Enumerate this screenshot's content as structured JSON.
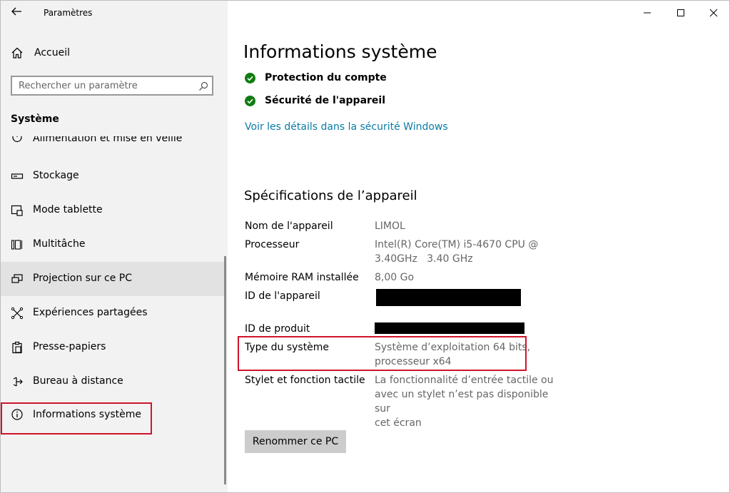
{
  "window": {
    "title": "Paramètres"
  },
  "sidebar": {
    "home_label": "Accueil",
    "search_placeholder": "Rechercher un paramètre",
    "section_label": "Système",
    "items": [
      {
        "label": "Alimentation et mise en veille",
        "icon": "power-icon"
      },
      {
        "label": "Stockage",
        "icon": "storage-icon"
      },
      {
        "label": "Mode tablette",
        "icon": "tablet-mode-icon"
      },
      {
        "label": "Multitâche",
        "icon": "multitasking-icon"
      },
      {
        "label": "Projection sur ce PC",
        "icon": "projection-icon"
      },
      {
        "label": "Expériences partagées",
        "icon": "shared-experiences-icon"
      },
      {
        "label": "Presse-papiers",
        "icon": "clipboard-icon"
      },
      {
        "label": "Bureau à distance",
        "icon": "remote-desktop-icon"
      },
      {
        "label": "Informations système",
        "icon": "info-icon"
      }
    ]
  },
  "main": {
    "title": "Informations système",
    "security": [
      {
        "label": "Protection du compte"
      },
      {
        "label": "Sécurité de l'appareil"
      }
    ],
    "security_link": "Voir les détails dans la sécurité Windows",
    "specs_heading": "Spécifications de l’appareil",
    "specs": {
      "device_name": {
        "label": "Nom de l'appareil",
        "value": "LIMOL"
      },
      "processor": {
        "label": "Processeur",
        "value_line1": "Intel(R) Core(TM) i5-4670 CPU @",
        "value_line2": "3.40GHz   3.40 GHz"
      },
      "ram": {
        "label": "Mémoire RAM installée",
        "value": "8,00 Go"
      },
      "device_id": {
        "label": "ID de l'appareil"
      },
      "product_id": {
        "label": "ID de produit"
      },
      "system_type": {
        "label": "Type du système",
        "value_line1": "Système d’exploitation 64 bits,",
        "value_line2": "processeur x64"
      },
      "pen_touch": {
        "label": "Stylet et fonction tactile",
        "value_line1": "La fonctionnalité d’entrée tactile ou",
        "value_line2": "avec un stylet n’est pas disponible sur",
        "value_line3": "cet écran"
      }
    },
    "rename_button": "Renommer ce PC"
  },
  "colors": {
    "accent_link": "#0a7ba5",
    "check_green": "#107c10",
    "highlight_red": "#d0142c",
    "sidebar_bg": "#f2f2f2",
    "selected_bg": "#e2e2e2"
  }
}
